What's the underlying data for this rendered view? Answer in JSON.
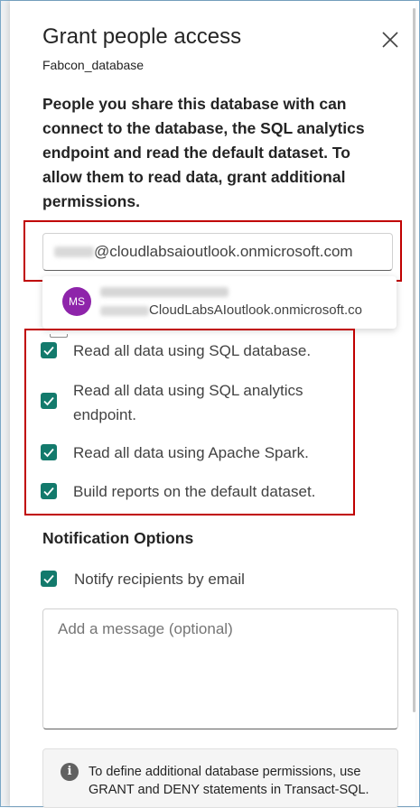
{
  "dialog": {
    "title": "Grant people access",
    "subtitle": "Fabcon_database",
    "close_icon": "close-icon",
    "description": "People you share this database with can connect to the database, the SQL analytics endpoint and read the default dataset. To allow them to read data, grant additional permissions."
  },
  "email_input": {
    "value_suffix": "@cloudlabsaioutlook.onmicrosoft.com"
  },
  "suggestion": {
    "initials": "MS",
    "avatar_color": "#8e24aa",
    "email_suffix": "CloudLabsAIoutlook.onmicrosoft.co"
  },
  "permissions": [
    {
      "label": "Read all data using SQL database.",
      "checked": true
    },
    {
      "label": "Read all data using SQL analytics endpoint.",
      "checked": true
    },
    {
      "label": "Read all data using Apache Spark.",
      "checked": true
    },
    {
      "label": "Build reports on the default dataset.",
      "checked": true
    }
  ],
  "notification": {
    "section_title": "Notification Options",
    "notify_label": "Notify recipients by email",
    "notify_checked": true,
    "message_placeholder": "Add a message (optional)"
  },
  "info": {
    "icon": "info-icon",
    "text": "To define additional database permissions, use GRANT and DENY statements in Transact-SQL."
  },
  "colors": {
    "checkbox": "#137a6c",
    "highlight": "#c00000"
  }
}
